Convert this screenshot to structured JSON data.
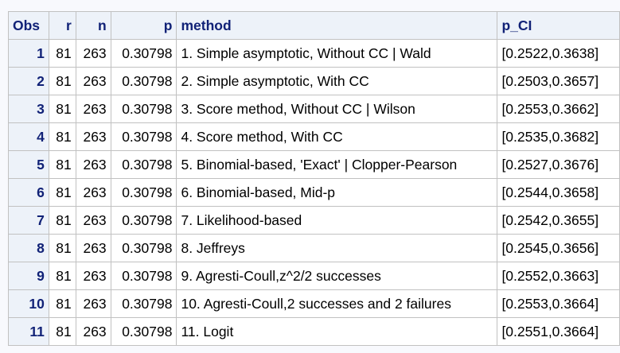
{
  "table": {
    "headers": [
      "Obs",
      "r",
      "n",
      "p",
      "method",
      "p_CI"
    ],
    "rows": [
      [
        "1",
        "81",
        "263",
        "0.30798",
        "1. Simple asymptotic, Without CC | Wald",
        "[0.2522,0.3638]"
      ],
      [
        "2",
        "81",
        "263",
        "0.30798",
        "2. Simple asymptotic, With CC",
        "[0.2503,0.3657]"
      ],
      [
        "3",
        "81",
        "263",
        "0.30798",
        "3. Score method, Without CC | Wilson",
        "[0.2553,0.3662]"
      ],
      [
        "4",
        "81",
        "263",
        "0.30798",
        "4. Score method, With CC",
        "[0.2535,0.3682]"
      ],
      [
        "5",
        "81",
        "263",
        "0.30798",
        "5. Binomial-based, 'Exact' | Clopper-Pearson",
        "[0.2527,0.3676]"
      ],
      [
        "6",
        "81",
        "263",
        "0.30798",
        "6. Binomial-based, Mid-p",
        "[0.2544,0.3658]"
      ],
      [
        "7",
        "81",
        "263",
        "0.30798",
        "7. Likelihood-based",
        "[0.2542,0.3655]"
      ],
      [
        "8",
        "81",
        "263",
        "0.30798",
        "8. Jeffreys",
        "[0.2545,0.3656]"
      ],
      [
        "9",
        "81",
        "263",
        "0.30798",
        "9. Agresti-Coull,z^2/2 successes",
        "[0.2552,0.3663]"
      ],
      [
        "10",
        "81",
        "263",
        "0.30798",
        "10. Agresti-Coull,2 successes and 2 failures",
        "[0.2553,0.3664]"
      ],
      [
        "11",
        "81",
        "263",
        "0.30798",
        "11. Logit",
        "[0.2551,0.3664]"
      ]
    ]
  }
}
